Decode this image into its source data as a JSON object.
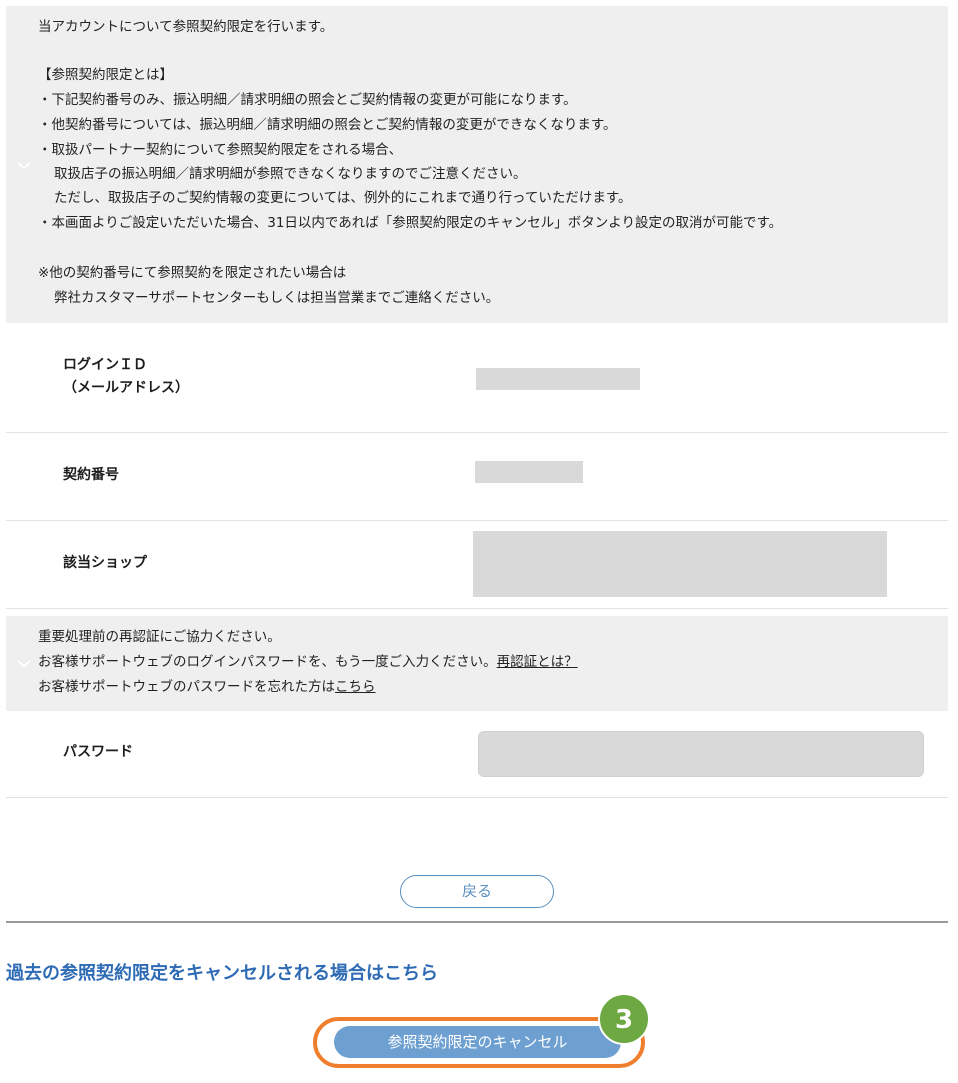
{
  "info1": {
    "lines": [
      "当アカウントについて参照契約限定を行います。",
      "【参照契約限定とは】",
      "・下記契約番号のみ、振込明細／請求明細の照会とご契約情報の変更が可能になります。",
      "・他契約番号については、振込明細／請求明細の照会とご契約情報の変更ができなくなります。",
      "・取扱パートナー契約について参照契約限定をされる場合、",
      "取扱店子の振込明細／請求明細が参照できなくなりますのでご注意ください。",
      "ただし、取扱店子のご契約情報の変更については、例外的にこれまで通り行っていただけます。",
      "・本画面よりご設定いただいた場合、31日以内であれば「参照契約限定のキャンセル」ボタンより設定の取消が可能です。",
      "※他の契約番号にて参照契約を限定されたい場合は",
      "弊社カスタマーサポートセンターもしくは担当営業までご連絡ください。"
    ]
  },
  "fields": {
    "login_id_label_1": "ログインＩＤ",
    "login_id_label_2": "（メールアドレス）",
    "contract_no_label": "契約番号",
    "shop_label": "該当ショップ",
    "password_label": "パスワード"
  },
  "info2": {
    "line1": "重要処理前の再認証にご協力ください。",
    "line2_text": "お客様サポートウェブのログインパスワードを、もう一度ご入力ください。",
    "line2_link": "再認証とは？",
    "line3_text": "お客様サポートウェブのパスワードを忘れた方は",
    "line3_link": "こちら"
  },
  "buttons": {
    "back": "戻る",
    "cancel": "参照契約限定のキャンセル"
  },
  "cancel_section": {
    "heading": "過去の参照契約限定をキャンセルされる場合はこちら"
  },
  "annotation": {
    "step": "3"
  },
  "colors": {
    "accent": "#2e6bb5",
    "cancel_button": "#6d9fd1",
    "highlight": "#ef7f2e",
    "badge": "#6da842"
  }
}
